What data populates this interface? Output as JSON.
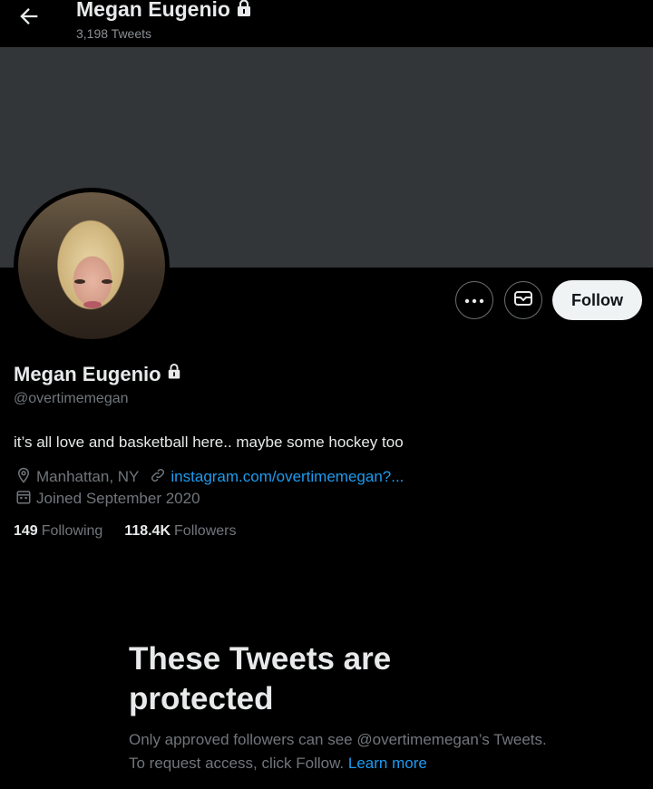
{
  "header": {
    "name": "Megan Eugenio",
    "tweet_count": "3,198 Tweets"
  },
  "profile": {
    "name": "Megan Eugenio",
    "handle": "@overtimemegan",
    "bio": "it’s all love and basketball here.. maybe some hockey too",
    "location": "Manhattan, NY",
    "link": "instagram.com/overtimemegan?...",
    "joined": "Joined September 2020",
    "following_count": "149",
    "following_label": "Following",
    "followers_count": "118.4K",
    "followers_label": "Followers"
  },
  "actions": {
    "follow_label": "Follow"
  },
  "protected": {
    "title": "These Tweets are protected",
    "text": "Only approved followers can see @overtimemegan’s Tweets. To request access, click Follow.",
    "learn_more": "Learn more"
  },
  "icons": [
    "back-arrow-icon",
    "lock-icon",
    "more-icon",
    "message-icon",
    "location-icon",
    "link-icon",
    "calendar-icon"
  ],
  "colors": {
    "accent": "#1d9bf0",
    "banner": "#333639",
    "background": "#000000"
  }
}
